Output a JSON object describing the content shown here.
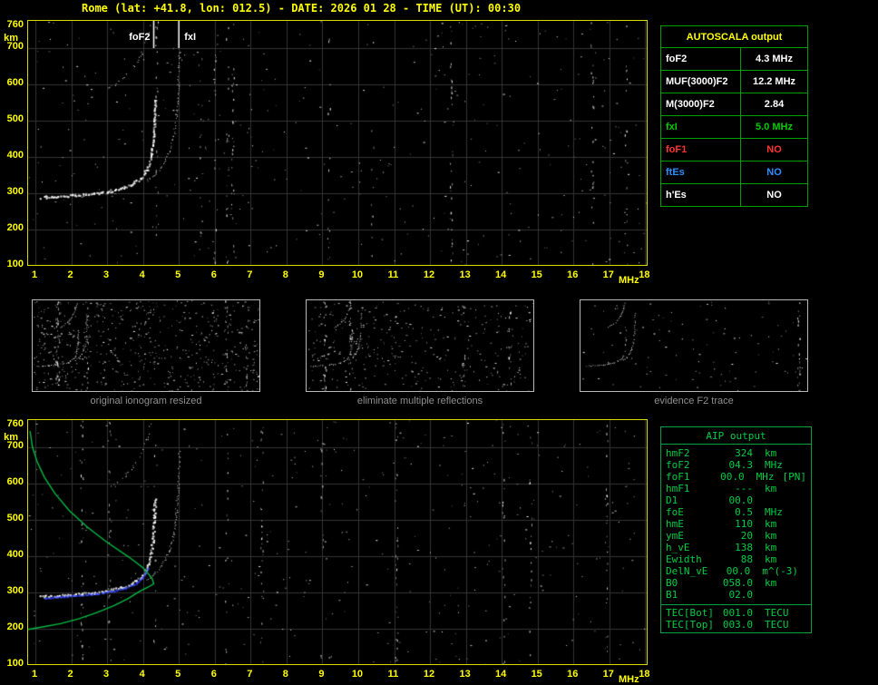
{
  "title": "Rome (lat: +41.8, lon: 012.5) - DATE: 2026 01 28 - TIME (UT): 00:30",
  "colors": {
    "background": "#000000",
    "title_text": "#ffff00",
    "plot_border": "#d6d600",
    "axis_text": "#ffff00",
    "grid": "#343434",
    "trace_white": "#ffffff",
    "profile_green": "#00bb44",
    "restored_blue": "#3344ff",
    "autoscala_border": "#00a000",
    "aip_green": "#00cc44",
    "caption_gray": "#8f8f8f"
  },
  "autoscala_table": {
    "title": "AUTOSCALA output",
    "rows": [
      {
        "label": "foF2",
        "value": "4.3 MHz",
        "color": "#ffffff"
      },
      {
        "label": "MUF(3000)F2",
        "value": "12.2 MHz",
        "color": "#ffffff"
      },
      {
        "label": "M(3000)F2",
        "value": "2.84",
        "color": "#ffffff"
      },
      {
        "label": "fxI",
        "value": "5.0 MHz",
        "color": "#00cc00"
      },
      {
        "label": "foF1",
        "value": "NO",
        "color": "#ff3333"
      },
      {
        "label": "ftEs",
        "value": "NO",
        "color": "#2f8fff"
      },
      {
        "label": "h'Es",
        "value": "NO",
        "color": "#ffffff"
      }
    ]
  },
  "thumbnails": [
    {
      "caption": "original ionogram resized"
    },
    {
      "caption": "eliminate multiple reflections"
    },
    {
      "caption": "evidence F2 trace"
    }
  ],
  "aip_table": {
    "title": "AIP output",
    "rows": [
      {
        "name": "hmF2",
        "value": "324",
        "unit": "km",
        "extra": ""
      },
      {
        "name": "foF2",
        "value": "04.3",
        "unit": "MHz",
        "extra": ""
      },
      {
        "name": "foF1",
        "value": "00.0",
        "unit": "MHz",
        "extra": "[PN]"
      },
      {
        "name": "hmF1",
        "value": "---",
        "unit": "km",
        "extra": ""
      },
      {
        "name": "D1",
        "value": "00.0",
        "unit": "",
        "extra": ""
      },
      {
        "name": "foE",
        "value": "0.5",
        "unit": "MHz",
        "extra": ""
      },
      {
        "name": "hmE",
        "value": "110",
        "unit": "km",
        "extra": ""
      },
      {
        "name": "ymE",
        "value": "20",
        "unit": "km",
        "extra": ""
      },
      {
        "name": "h_vE",
        "value": "138",
        "unit": "km",
        "extra": ""
      },
      {
        "name": "Ewidth",
        "value": "88",
        "unit": "km",
        "extra": ""
      },
      {
        "name": "DelN_vE",
        "value": "00.0",
        "unit": "m^(-3)",
        "extra": ""
      },
      {
        "name": "B0",
        "value": "058.0",
        "unit": "km",
        "extra": ""
      },
      {
        "name": "B1",
        "value": "02.0",
        "unit": "",
        "extra": ""
      }
    ],
    "tec_rows": [
      {
        "name": "TEC[Bot]",
        "value": "001.0",
        "unit": "TECU"
      },
      {
        "name": "TEC[Top]",
        "value": "003.0",
        "unit": "TECU"
      }
    ]
  },
  "chart_data": [
    {
      "type": "scatter",
      "title": "scaled ionogram with autoscaled critical frequencies",
      "xlabel": "MHz",
      "ylabel": "km",
      "xlim": [
        1,
        18
      ],
      "ylim": [
        100,
        760
      ],
      "x_ticks": [
        1,
        2,
        3,
        4,
        5,
        6,
        7,
        8,
        9,
        10,
        11,
        12,
        13,
        14,
        15,
        16,
        17,
        18
      ],
      "y_ticks": [
        760,
        700,
        600,
        500,
        400,
        300,
        200,
        100
      ],
      "grid": true,
      "annotations": [
        {
          "label": "foF2",
          "x_mhz": 4.3
        },
        {
          "label": "fxI",
          "x_mhz": 5.0
        }
      ],
      "series": [
        {
          "name": "O-mode F2 trace",
          "color": "#ffffff",
          "render": "dots",
          "points": [
            [
              1.15,
              290
            ],
            [
              1.6,
              293
            ],
            [
              2.1,
              296
            ],
            [
              2.6,
              300
            ],
            [
              3.0,
              306
            ],
            [
              3.4,
              315
            ],
            [
              3.7,
              327
            ],
            [
              3.95,
              345
            ],
            [
              4.1,
              368
            ],
            [
              4.2,
              400
            ],
            [
              4.27,
              450
            ],
            [
              4.3,
              505
            ],
            [
              4.32,
              560
            ]
          ]
        },
        {
          "name": "X-mode F2 trace",
          "color": "#ffffff",
          "render": "dots",
          "points": [
            [
              4.1,
              335
            ],
            [
              4.35,
              355
            ],
            [
              4.55,
              380
            ],
            [
              4.72,
              415
            ],
            [
              4.85,
              460
            ],
            [
              4.93,
              520
            ],
            [
              4.98,
              600
            ],
            [
              5.01,
              690
            ]
          ]
        },
        {
          "name": "second-hop F2 trace",
          "color": "#ffffff",
          "render": "dots",
          "points": [
            [
              2.95,
              585
            ],
            [
              3.2,
              600
            ],
            [
              3.5,
              622
            ],
            [
              3.75,
              650
            ],
            [
              3.95,
              685
            ],
            [
              4.1,
              725
            ],
            [
              4.2,
              765
            ]
          ]
        }
      ]
    },
    {
      "type": "scatter",
      "title": "ionogram with restored electron density profile",
      "xlabel": "MHz",
      "ylabel": "km",
      "xlim": [
        1,
        18
      ],
      "ylim": [
        100,
        760
      ],
      "x_ticks": [
        1,
        2,
        3,
        4,
        5,
        6,
        7,
        8,
        9,
        10,
        11,
        12,
        13,
        14,
        15,
        16,
        17,
        18
      ],
      "y_ticks": [
        760,
        700,
        600,
        500,
        400,
        300,
        200,
        100
      ],
      "grid": true,
      "key_values": {
        "hmF2_km": 324,
        "foF2_mhz": 4.3
      },
      "series": [
        {
          "name": "O-mode F2 trace",
          "color": "#ffffff",
          "render": "dots",
          "points": [
            [
              1.15,
              290
            ],
            [
              1.6,
              293
            ],
            [
              2.1,
              296
            ],
            [
              2.6,
              300
            ],
            [
              3.0,
              306
            ],
            [
              3.4,
              315
            ],
            [
              3.7,
              327
            ],
            [
              3.95,
              345
            ],
            [
              4.1,
              368
            ],
            [
              4.2,
              400
            ],
            [
              4.27,
              450
            ],
            [
              4.3,
              505
            ],
            [
              4.32,
              560
            ]
          ]
        },
        {
          "name": "X-mode F2 trace",
          "color": "#ffffff",
          "render": "dots",
          "points": [
            [
              4.1,
              335
            ],
            [
              4.35,
              355
            ],
            [
              4.55,
              380
            ],
            [
              4.72,
              415
            ],
            [
              4.85,
              460
            ],
            [
              4.93,
              520
            ],
            [
              4.98,
              600
            ],
            [
              5.01,
              690
            ]
          ]
        },
        {
          "name": "second-hop F2 trace",
          "color": "#ffffff",
          "render": "dots",
          "points": [
            [
              2.95,
              585
            ],
            [
              3.2,
              600
            ],
            [
              3.5,
              622
            ],
            [
              3.75,
              650
            ],
            [
              3.95,
              685
            ],
            [
              4.1,
              725
            ],
            [
              4.2,
              765
            ]
          ]
        },
        {
          "name": "electron density profile",
          "color": "#00bb44",
          "render": "line",
          "points": [
            [
              0.5,
              192
            ],
            [
              0.8,
              198
            ],
            [
              1.2,
              205
            ],
            [
              1.7,
              214
            ],
            [
              2.2,
              227
            ],
            [
              2.7,
              244
            ],
            [
              3.2,
              264
            ],
            [
              3.6,
              284
            ],
            [
              3.9,
              303
            ],
            [
              4.15,
              315
            ],
            [
              4.3,
              324
            ],
            [
              4.25,
              340
            ],
            [
              4.0,
              368
            ],
            [
              3.6,
              398
            ],
            [
              3.0,
              438
            ],
            [
              2.45,
              480
            ],
            [
              1.95,
              525
            ],
            [
              1.55,
              572
            ],
            [
              1.25,
              618
            ],
            [
              1.05,
              660
            ],
            [
              0.92,
              700
            ],
            [
              0.85,
              745
            ]
          ]
        },
        {
          "name": "restored trace",
          "color": "#3344ff",
          "render": "dots",
          "points": [
            [
              1.25,
              286
            ],
            [
              1.7,
              289
            ],
            [
              2.2,
              293
            ],
            [
              2.7,
              298
            ],
            [
              3.1,
              304
            ],
            [
              3.5,
              313
            ],
            [
              3.8,
              326
            ],
            [
              4.0,
              345
            ],
            [
              4.12,
              368
            ]
          ]
        }
      ]
    }
  ]
}
